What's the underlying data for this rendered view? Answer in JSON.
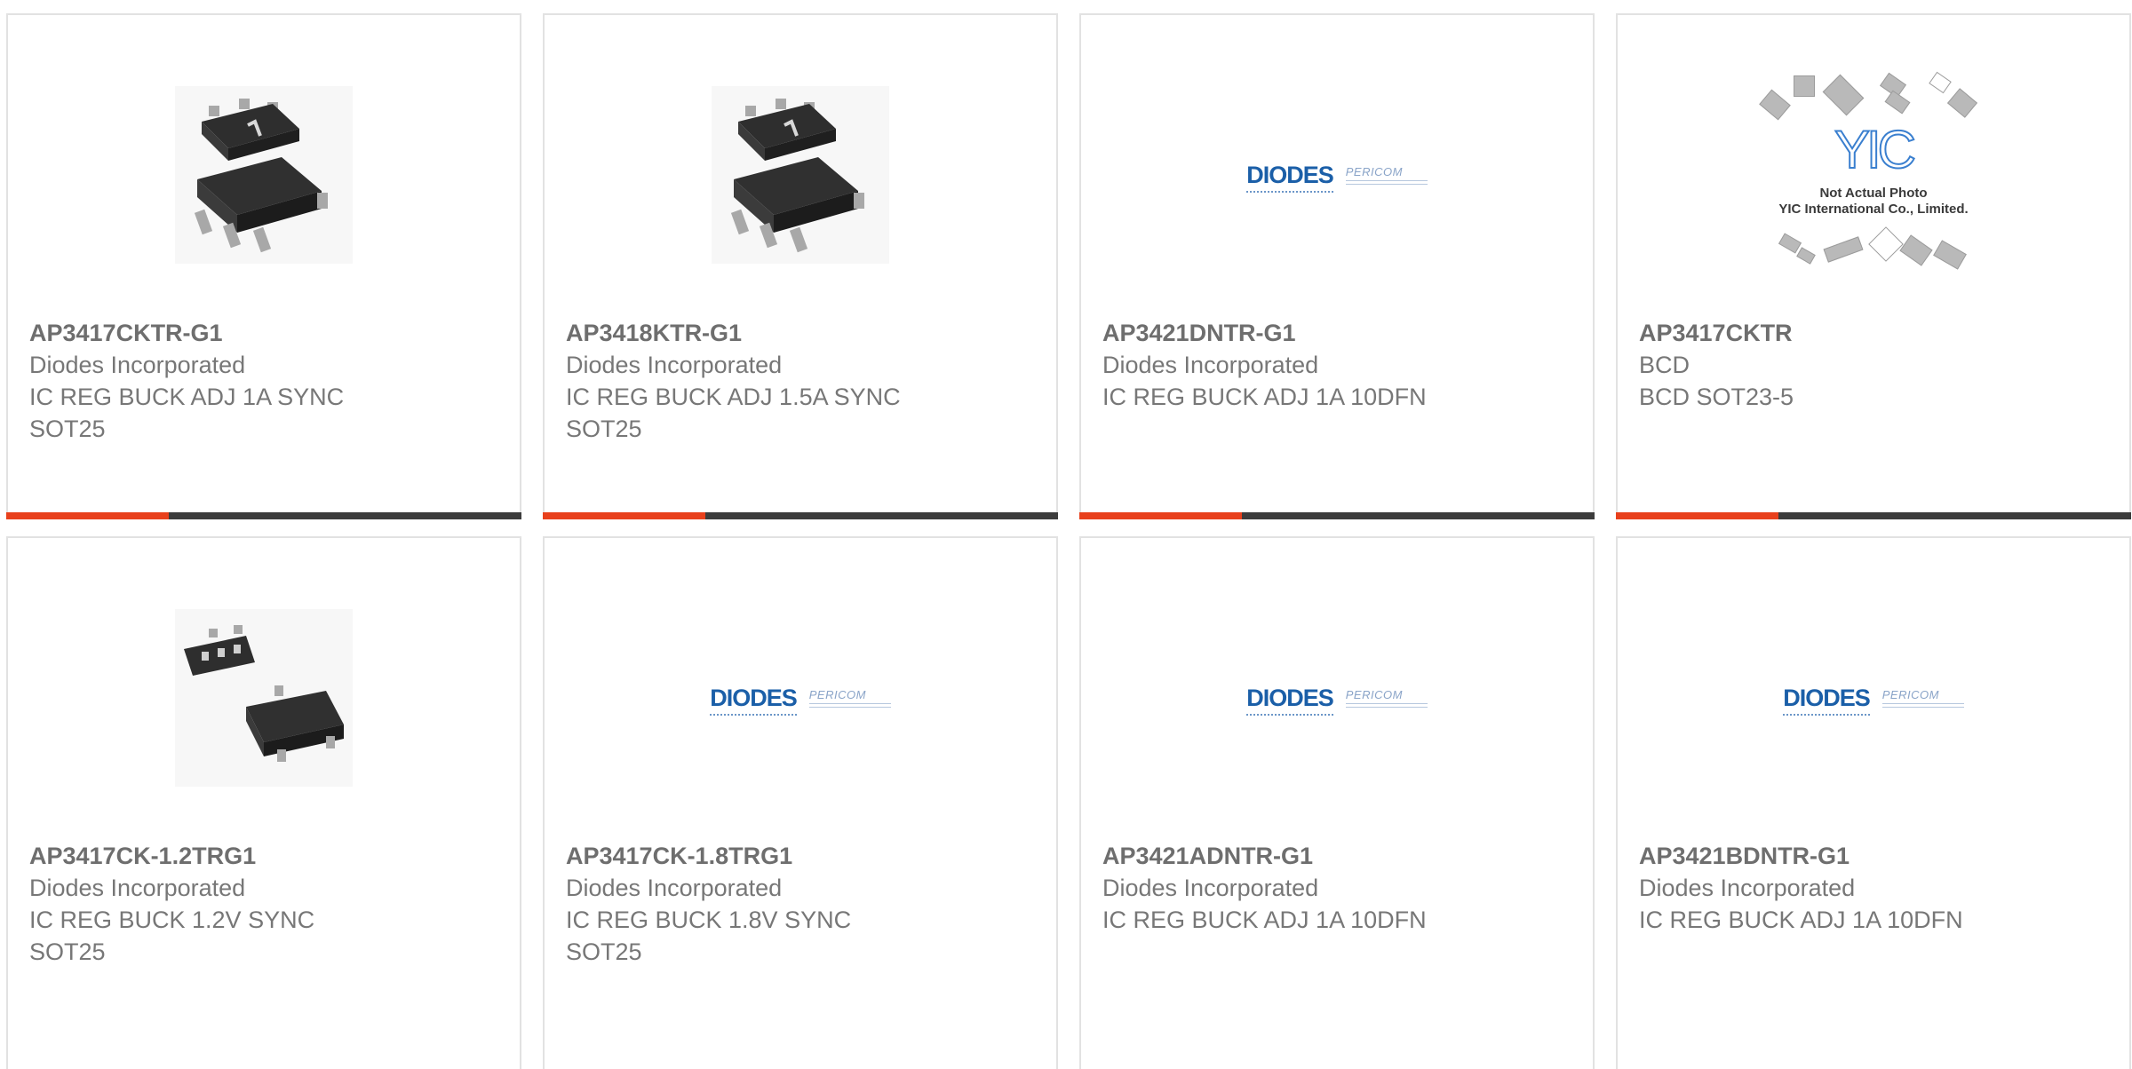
{
  "products": [
    {
      "part_number": "AP3417CKTR-G1",
      "manufacturer": "Diodes Incorporated",
      "description": "IC REG BUCK ADJ 1A SYNC SOT25",
      "image": "sot25-package-photo"
    },
    {
      "part_number": "AP3418KTR-G1",
      "manufacturer": "Diodes Incorporated",
      "description": "IC REG BUCK ADJ 1.5A SYNC SOT25",
      "image": "sot25-package-photo"
    },
    {
      "part_number": "AP3421DNTR-G1",
      "manufacturer": "Diodes Incorporated",
      "description": "IC REG BUCK ADJ 1A 10DFN",
      "image": "diodes-pericom-logo"
    },
    {
      "part_number": "AP3417CKTR",
      "manufacturer": "BCD",
      "description": "BCD SOT23-5",
      "image": "not-actual-photo-placeholder"
    },
    {
      "part_number": "AP3417CK-1.2TRG1",
      "manufacturer": "Diodes Incorporated",
      "description": "IC REG BUCK 1.2V SYNC SOT25",
      "image": "sot25-package-photo"
    },
    {
      "part_number": "AP3417CK-1.8TRG1",
      "manufacturer": "Diodes Incorporated",
      "description": "IC REG BUCK 1.8V SYNC SOT25",
      "image": "diodes-pericom-logo"
    },
    {
      "part_number": "AP3421ADNTR-G1",
      "manufacturer": "Diodes Incorporated",
      "description": "IC REG BUCK ADJ 1A 10DFN",
      "image": "diodes-pericom-logo"
    },
    {
      "part_number": "AP3421BDNTR-G1",
      "manufacturer": "Diodes Incorporated",
      "description": "IC REG BUCK ADJ 1A 10DFN",
      "image": "diodes-pericom-logo"
    }
  ],
  "logo_text": {
    "diodes": "DIODES",
    "pericom": "PERICOM"
  },
  "placeholder": {
    "line1": "Not Actual Photo",
    "line2": "YIC International Co., Limited.",
    "mark": "YIC"
  },
  "colors": {
    "accent": "#e8401c",
    "bar": "#3c3c3c",
    "text": "#777777",
    "diodes_blue": "#1b5fa8"
  }
}
